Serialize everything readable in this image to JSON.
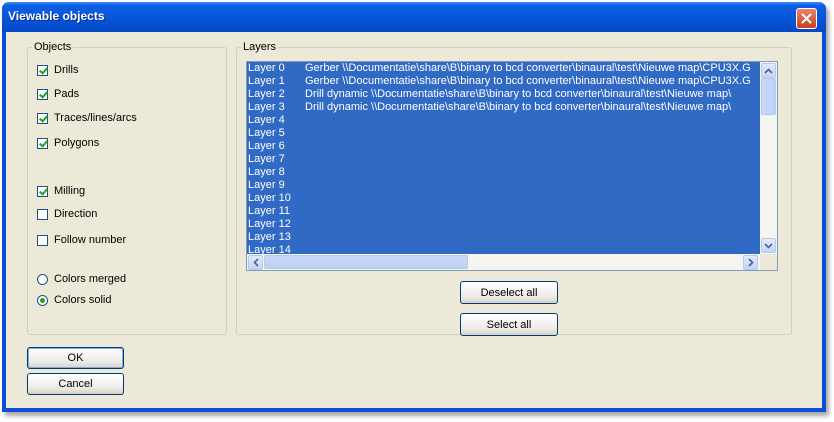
{
  "window": {
    "title": "Viewable objects"
  },
  "objects": {
    "legend": "Objects",
    "checkboxes": [
      {
        "label": "Drills",
        "checked": true
      },
      {
        "label": "Pads",
        "checked": true
      },
      {
        "label": "Traces/lines/arcs",
        "checked": true
      },
      {
        "label": "Polygons",
        "checked": true
      },
      {
        "label": "Milling",
        "checked": true
      },
      {
        "label": "Direction",
        "checked": false
      },
      {
        "label": "Follow number",
        "checked": false
      }
    ],
    "radios": [
      {
        "label": "Colors merged",
        "selected": false
      },
      {
        "label": "Colors solid",
        "selected": true
      }
    ]
  },
  "layers": {
    "legend": "Layers",
    "items": [
      {
        "name": "Layer 0",
        "detail": "Gerber   \\\\Documentatie\\share\\B\\binary to bcd converter\\binaural\\test\\Nieuwe map\\CPU3X.G"
      },
      {
        "name": "Layer 1",
        "detail": "Gerber   \\\\Documentatie\\share\\B\\binary to bcd converter\\binaural\\test\\Nieuwe map\\CPU3X.G"
      },
      {
        "name": "Layer 2",
        "detail": "Drill dynamic       \\\\Documentatie\\share\\B\\binary to bcd converter\\binaural\\test\\Nieuwe map\\"
      },
      {
        "name": "Layer 3",
        "detail": "Drill dynamic       \\\\Documentatie\\share\\B\\binary to bcd converter\\binaural\\test\\Nieuwe map\\"
      },
      {
        "name": "Layer 4",
        "detail": ""
      },
      {
        "name": "Layer 5",
        "detail": ""
      },
      {
        "name": "Layer 6",
        "detail": ""
      },
      {
        "name": "Layer 7",
        "detail": ""
      },
      {
        "name": "Layer 8",
        "detail": ""
      },
      {
        "name": "Layer 9",
        "detail": ""
      },
      {
        "name": "Layer 10",
        "detail": ""
      },
      {
        "name": "Layer 11",
        "detail": ""
      },
      {
        "name": "Layer 12",
        "detail": ""
      },
      {
        "name": "Layer 13",
        "detail": ""
      },
      {
        "name": "Layer 14",
        "detail": ""
      }
    ]
  },
  "buttons": {
    "deselect_all": "Deselect all",
    "select_all": "Select all",
    "ok": "OK",
    "cancel": "Cancel"
  },
  "colors": {
    "title_bar": "#0653d8",
    "selection": "#316ac5",
    "dialog_bg": "#ece9d8",
    "check_mark": "#21a121"
  }
}
